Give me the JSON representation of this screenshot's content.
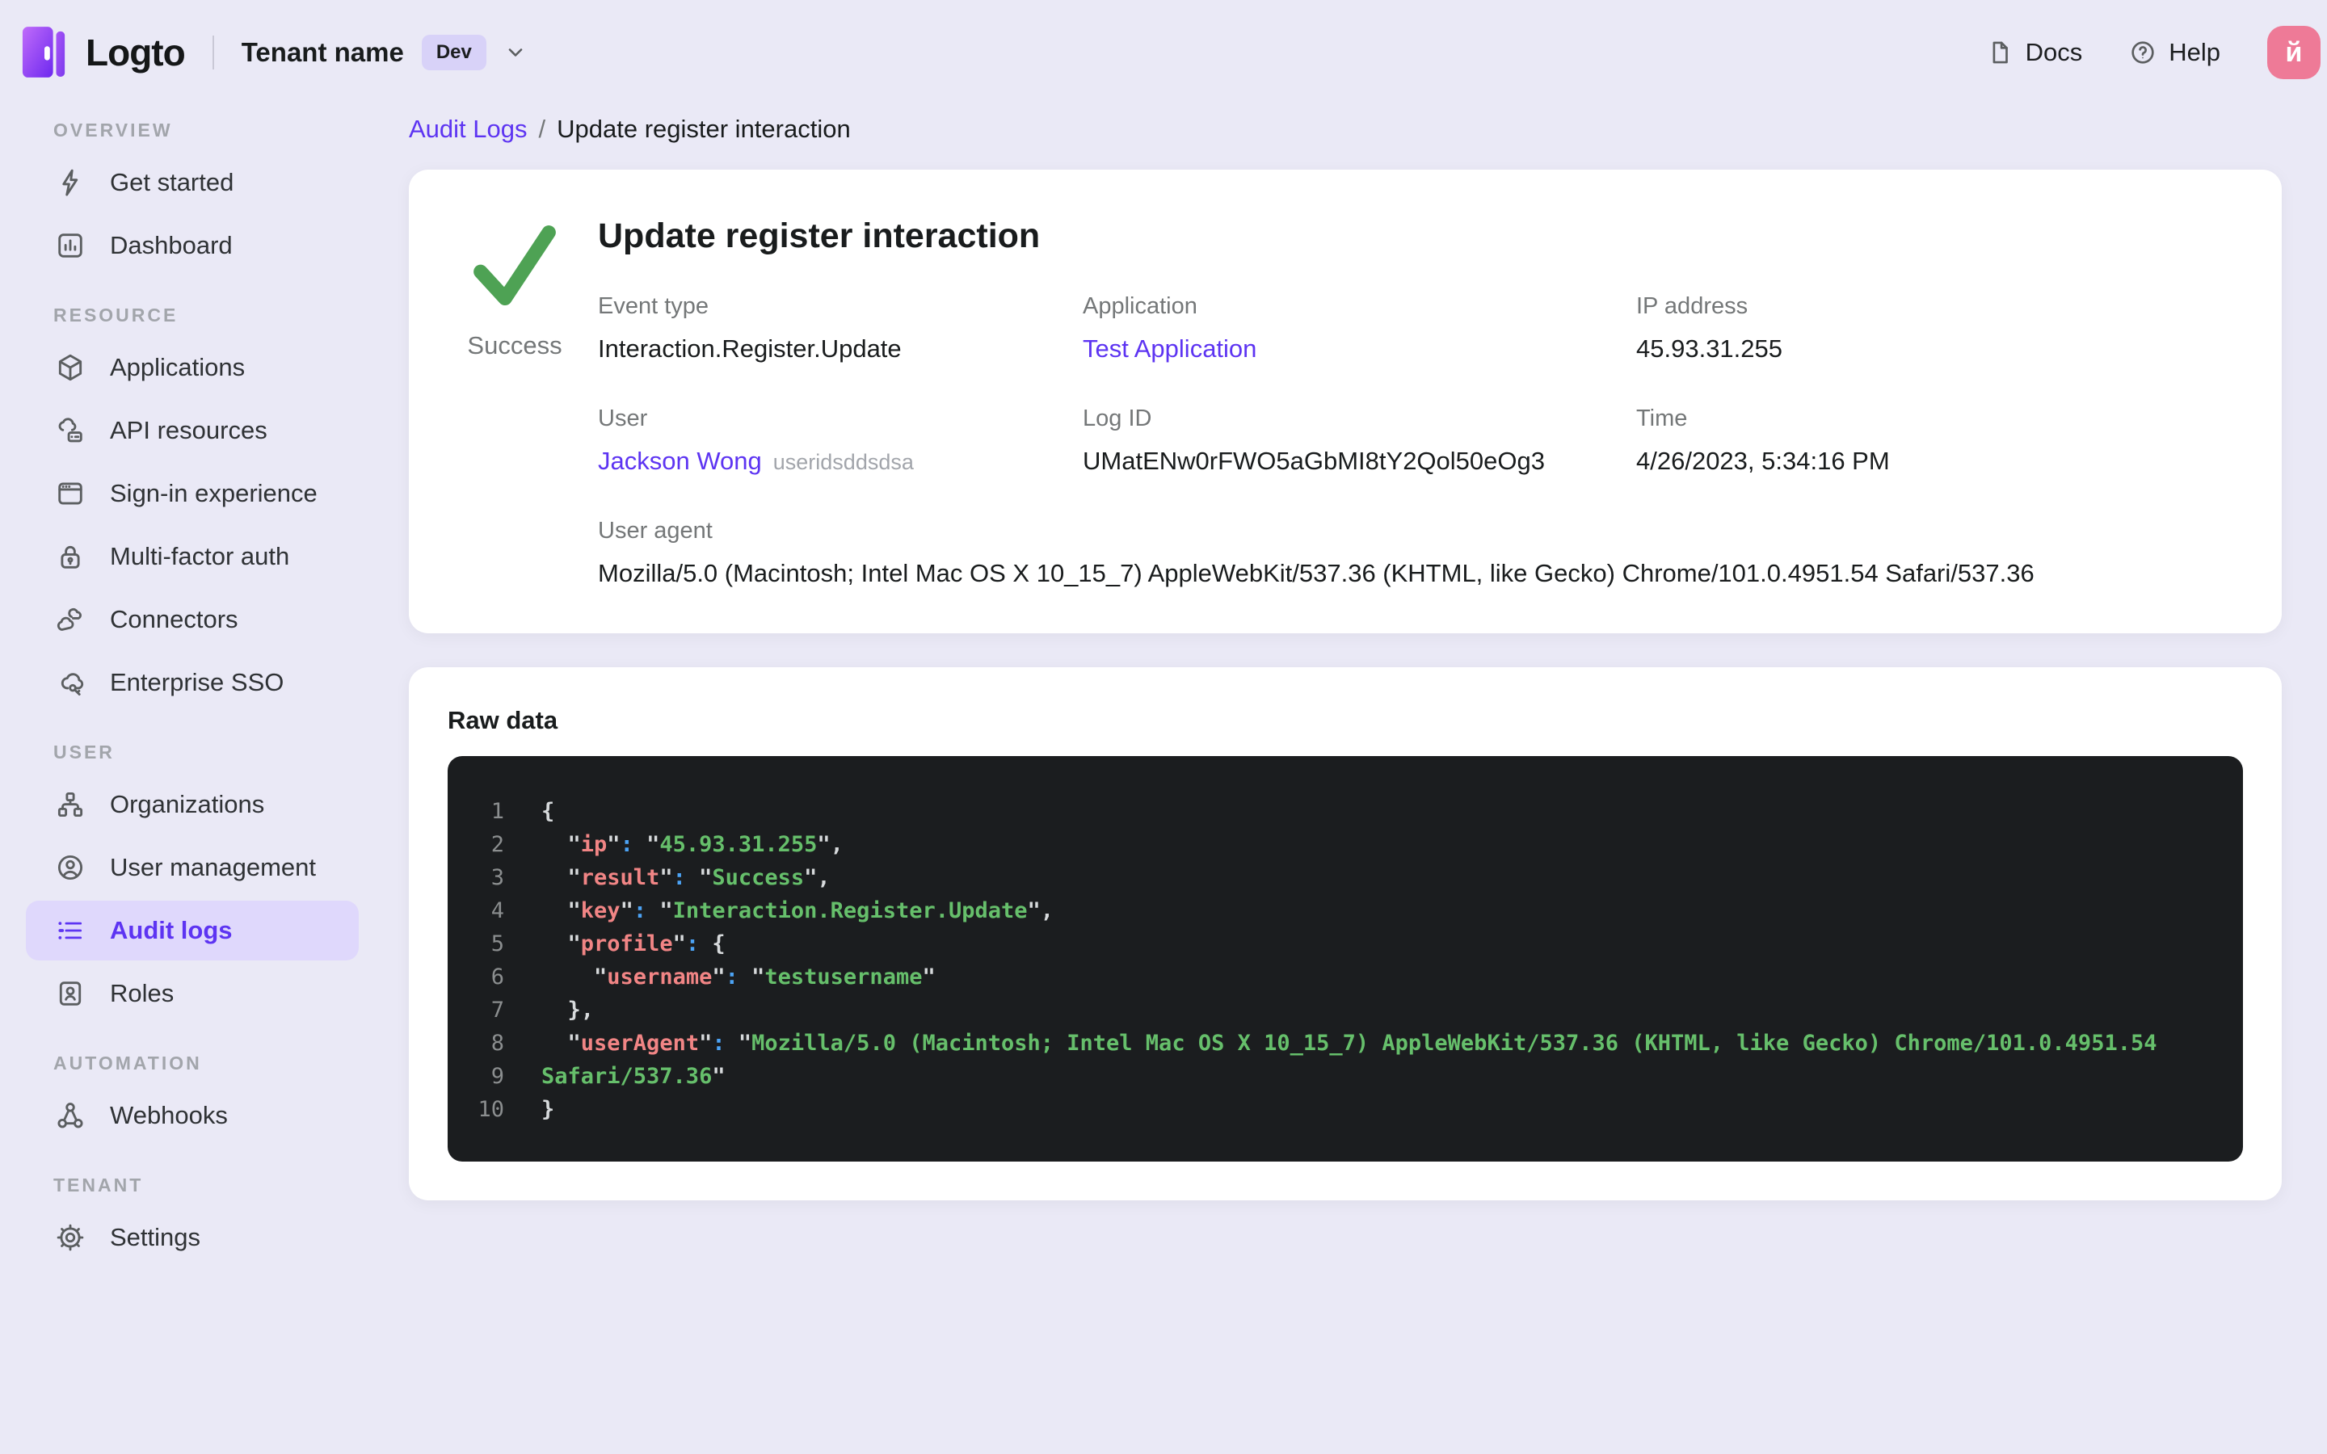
{
  "colors": {
    "page-bg": "#eae9f6",
    "accent": "#5d34f2",
    "pill-bg": "#dfd8fc",
    "avatar-bg": "#ee7a97",
    "success-green": "#4ea254",
    "code-bg": "#1b1d1f",
    "code-lineno": "#8b8e8f",
    "code-punct": "#d7dadc",
    "code-key": "#f18585",
    "code-colon": "#4ca3f5",
    "code-string": "#66bf6b"
  },
  "topbar": {
    "brand": "Logto",
    "tenant_name": "Tenant name",
    "tenant_badge": "Dev",
    "docs_label": "Docs",
    "help_label": "Help",
    "avatar_initial": "й"
  },
  "sidebar": {
    "sections": [
      {
        "label": "OVERVIEW",
        "items": [
          {
            "icon": "bolt-icon",
            "label": "Get started"
          },
          {
            "icon": "dashboard-icon",
            "label": "Dashboard"
          }
        ]
      },
      {
        "label": "RESOURCE",
        "items": [
          {
            "icon": "applications-icon",
            "label": "Applications"
          },
          {
            "icon": "api-resources-icon",
            "label": "API resources"
          },
          {
            "icon": "sign-in-icon",
            "label": "Sign-in experience"
          },
          {
            "icon": "mfa-icon",
            "label": "Multi-factor auth"
          },
          {
            "icon": "connectors-icon",
            "label": "Connectors"
          },
          {
            "icon": "enterprise-sso-icon",
            "label": "Enterprise SSO"
          }
        ]
      },
      {
        "label": "USER",
        "items": [
          {
            "icon": "organizations-icon",
            "label": "Organizations"
          },
          {
            "icon": "user-management-icon",
            "label": "User management"
          },
          {
            "icon": "audit-logs-icon",
            "label": "Audit logs",
            "active": true
          },
          {
            "icon": "roles-icon",
            "label": "Roles"
          }
        ]
      },
      {
        "label": "AUTOMATION",
        "items": [
          {
            "icon": "webhooks-icon",
            "label": "Webhooks"
          }
        ]
      },
      {
        "label": "TENANT",
        "items": [
          {
            "icon": "settings-icon",
            "label": "Settings"
          }
        ]
      }
    ]
  },
  "breadcrumb": {
    "parent": "Audit Logs",
    "separator": "/",
    "current": "Update register interaction"
  },
  "event": {
    "title": "Update register interaction",
    "status": "Success",
    "fields": [
      {
        "label": "Event type",
        "value": "Interaction.Register.Update"
      },
      {
        "label": "Application",
        "value": "Test Application",
        "link": true
      },
      {
        "label": "IP address",
        "value": "45.93.31.255"
      },
      {
        "label": "User",
        "value": "Jackson Wong",
        "link": true,
        "suffix": "useridsddsdsa"
      },
      {
        "label": "Log ID",
        "value": "UMatENw0rFWO5aGbMI8tY2Qol50eOg3"
      },
      {
        "label": "Time",
        "value": "4/26/2023, 5:34:16 PM"
      },
      {
        "label": "User agent",
        "value": "Mozilla/5.0 (Macintosh; Intel Mac OS X 10_15_7) AppleWebKit/537.36 (KHTML, like Gecko) Chrome/101.0.4951.54 Safari/537.36",
        "wide": true
      }
    ]
  },
  "raw_data": {
    "title": "Raw data",
    "lines": [
      {
        "n": "1",
        "seg": [
          [
            "p",
            "{"
          ]
        ]
      },
      {
        "n": "2",
        "seg": [
          [
            "p",
            "  \""
          ],
          [
            "k",
            "ip"
          ],
          [
            "p",
            "\""
          ],
          [
            "c",
            ":"
          ],
          [
            "p",
            " \""
          ],
          [
            "s",
            "45.93.31.255"
          ],
          [
            "p",
            "\","
          ]
        ]
      },
      {
        "n": "3",
        "seg": [
          [
            "p",
            "  \""
          ],
          [
            "k",
            "result"
          ],
          [
            "p",
            "\""
          ],
          [
            "c",
            ":"
          ],
          [
            "p",
            " \""
          ],
          [
            "s",
            "Success"
          ],
          [
            "p",
            "\","
          ]
        ]
      },
      {
        "n": "4",
        "seg": [
          [
            "p",
            "  \""
          ],
          [
            "k",
            "key"
          ],
          [
            "p",
            "\""
          ],
          [
            "c",
            ":"
          ],
          [
            "p",
            " \""
          ],
          [
            "s",
            "Interaction.Register.Update"
          ],
          [
            "p",
            "\","
          ]
        ]
      },
      {
        "n": "5",
        "seg": [
          [
            "p",
            "  \""
          ],
          [
            "k",
            "profile"
          ],
          [
            "p",
            "\""
          ],
          [
            "c",
            ":"
          ],
          [
            "p",
            " {"
          ]
        ]
      },
      {
        "n": "6",
        "seg": [
          [
            "p",
            "    \""
          ],
          [
            "k",
            "username"
          ],
          [
            "p",
            "\""
          ],
          [
            "c",
            ":"
          ],
          [
            "p",
            " \""
          ],
          [
            "s",
            "testusername"
          ],
          [
            "p",
            "\""
          ]
        ]
      },
      {
        "n": "7",
        "seg": [
          [
            "p",
            "  },"
          ]
        ]
      },
      {
        "n": "8",
        "seg": [
          [
            "p",
            "  \""
          ],
          [
            "k",
            "userAgent"
          ],
          [
            "p",
            "\""
          ],
          [
            "c",
            ":"
          ],
          [
            "p",
            " \""
          ],
          [
            "s",
            "Mozilla/5.0 (Macintosh; Intel Mac OS X 10_15_7) AppleWebKit/537.36 (KHTML, like Gecko) Chrome/101.0.4951.54"
          ]
        ]
      },
      {
        "n": "9",
        "seg": [
          [
            "s",
            "Safari/537.36"
          ],
          [
            "p",
            "\""
          ]
        ]
      },
      {
        "n": "10",
        "seg": [
          [
            "p",
            "}"
          ]
        ]
      }
    ]
  }
}
